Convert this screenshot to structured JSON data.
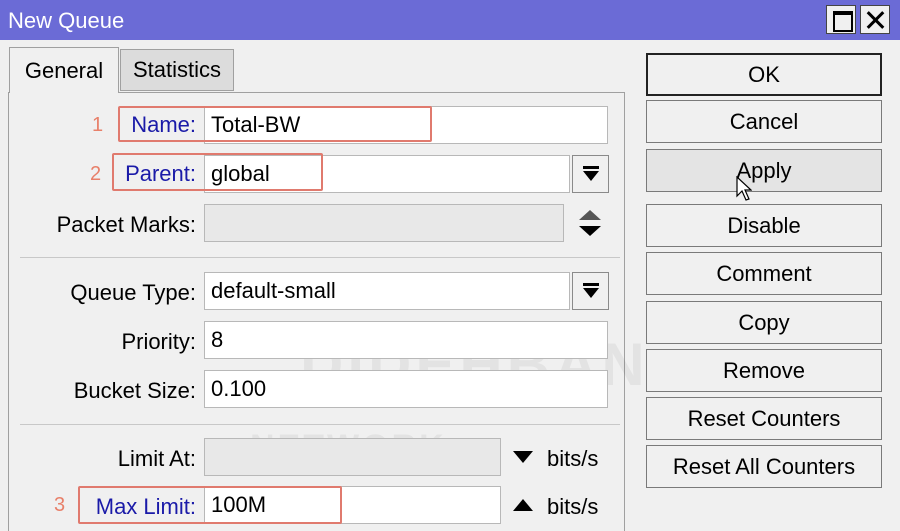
{
  "window": {
    "title": "New Queue"
  },
  "tabs": {
    "general": "General",
    "statistics": "Statistics"
  },
  "form": {
    "name": {
      "label": "Name:",
      "value": "Total-BW",
      "marker": "1"
    },
    "parent": {
      "label": "Parent:",
      "value": "global",
      "marker": "2"
    },
    "packet_marks": {
      "label": "Packet Marks:",
      "value": ""
    },
    "queue_type": {
      "label": "Queue Type:",
      "value": "default-small"
    },
    "priority": {
      "label": "Priority:",
      "value": "8"
    },
    "bucket_size": {
      "label": "Bucket Size:",
      "value": "0.100"
    },
    "limit_at": {
      "label": "Limit At:",
      "value": "",
      "unit": "bits/s"
    },
    "max_limit": {
      "label": "Max Limit:",
      "value": "100M",
      "unit": "bits/s",
      "marker": "3"
    }
  },
  "buttons": {
    "ok": "OK",
    "cancel": "Cancel",
    "apply": "Apply",
    "disable": "Disable",
    "comment": "Comment",
    "copy": "Copy",
    "remove": "Remove",
    "reset_counters": "Reset Counters",
    "reset_all_counters": "Reset All Counters"
  },
  "colors": {
    "titlebar": "#6b6bd6",
    "highlight": "#e07a6e",
    "label_blue": "#1a1aa8"
  }
}
